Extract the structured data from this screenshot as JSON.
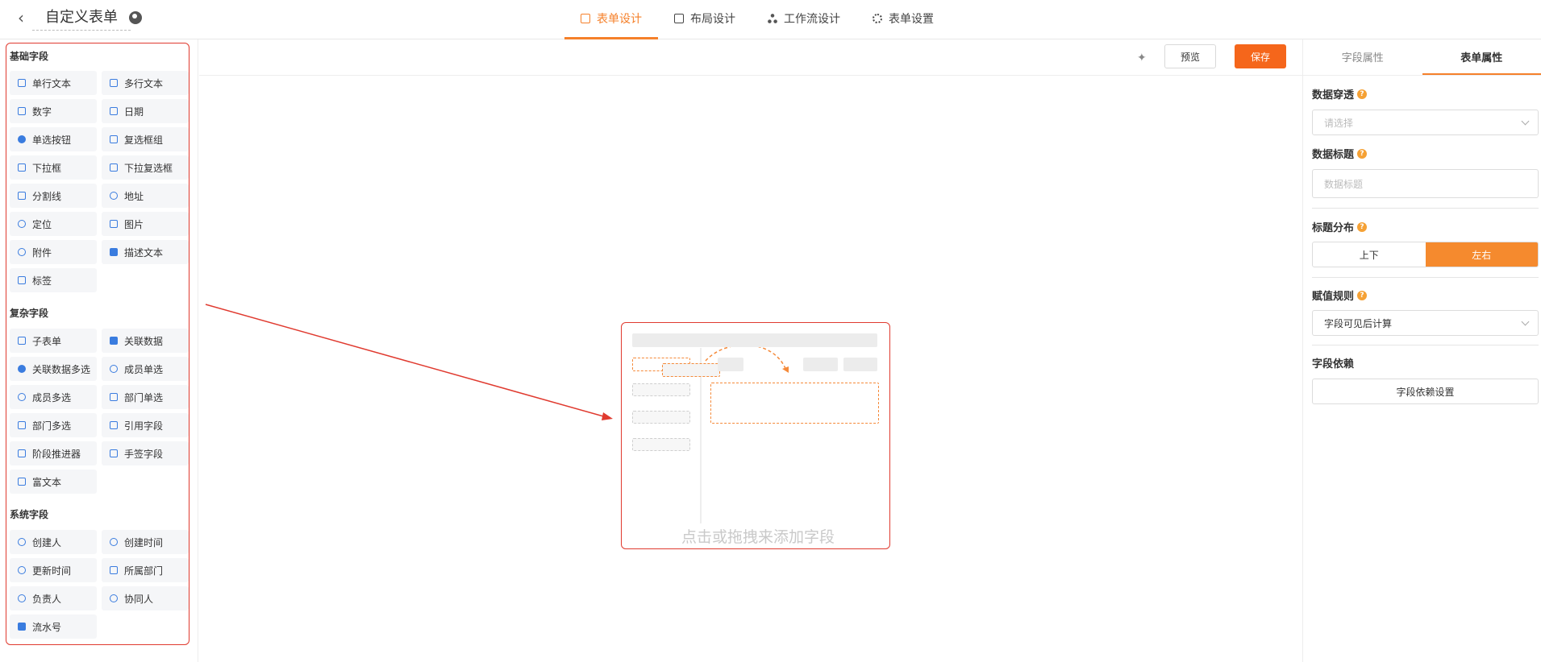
{
  "header": {
    "back": "<",
    "title": "自定义表单",
    "tabs": [
      {
        "label": "表单设计",
        "active": true
      },
      {
        "label": "布局设计"
      },
      {
        "label": "工作流设计"
      },
      {
        "label": "表单设置"
      }
    ]
  },
  "left": {
    "groups": [
      {
        "title": "基础字段",
        "items": [
          "单行文本",
          "多行文本",
          "数字",
          "日期",
          "单选按钮",
          "复选框组",
          "下拉框",
          "下拉复选框",
          "分割线",
          "地址",
          "定位",
          "图片",
          "附件",
          "描述文本",
          "标签"
        ]
      },
      {
        "title": "复杂字段",
        "items": [
          "子表单",
          "关联数据",
          "关联数据多选",
          "成员单选",
          "成员多选",
          "部门单选",
          "部门多选",
          "引用字段",
          "阶段推进器",
          "手签字段",
          "富文本"
        ]
      },
      {
        "title": "系统字段",
        "items": [
          "创建人",
          "创建时间",
          "更新时间",
          "所属部门",
          "负责人",
          "协同人",
          "流水号"
        ]
      }
    ]
  },
  "toolbar": {
    "preview": "预览",
    "save": "保存"
  },
  "canvas": {
    "empty_hint": "点击或拖拽来添加字段"
  },
  "right": {
    "tabs": [
      {
        "label": "字段属性"
      },
      {
        "label": "表单属性",
        "active": true
      }
    ],
    "data_through": {
      "label": "数据穿透",
      "placeholder": "请选择"
    },
    "data_title": {
      "label": "数据标题",
      "placeholder": "数据标题"
    },
    "title_layout": {
      "label": "标题分布",
      "options": [
        "上下",
        "左右"
      ],
      "selected": "左右"
    },
    "assign_rule": {
      "label": "赋值规则",
      "value": "字段可见后计算"
    },
    "field_dep": {
      "label": "字段依赖",
      "button": "字段依赖设置"
    }
  },
  "colors": {
    "accent": "#f5802a",
    "save": "#f5661b",
    "highlight": "#e03a2f",
    "icon": "#3a7cdf"
  }
}
